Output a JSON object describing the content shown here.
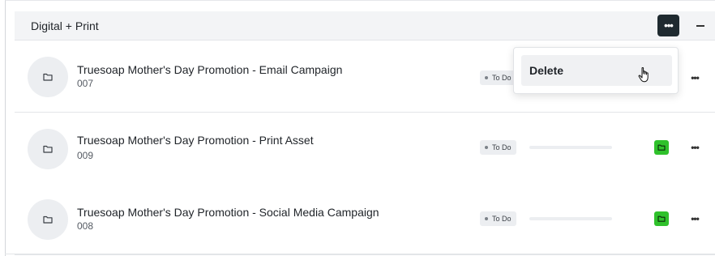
{
  "group": {
    "title": "Digital + Print",
    "more_icon": "more-horizontal-icon",
    "collapse_icon": "minus-icon"
  },
  "rows": [
    {
      "title": "Truesoap Mother's Day Promotion - Email Campaign",
      "code": "007",
      "status": "To Do",
      "progress": 0,
      "icon": "folder-icon"
    },
    {
      "title": "Truesoap Mother's Day Promotion - Print Asset",
      "code": "009",
      "status": "To Do",
      "progress": 0,
      "icon": "folder-icon"
    },
    {
      "title": "Truesoap Mother's Day Promotion - Social Media Campaign",
      "code": "008",
      "status": "To Do",
      "progress": 0,
      "icon": "folder-icon"
    }
  ],
  "dropdown": {
    "items": [
      {
        "label": "Delete"
      }
    ]
  },
  "colors": {
    "accent_green": "#2fc12b",
    "dark_button": "#1f2a30",
    "header_bg": "#f3f4f6"
  }
}
